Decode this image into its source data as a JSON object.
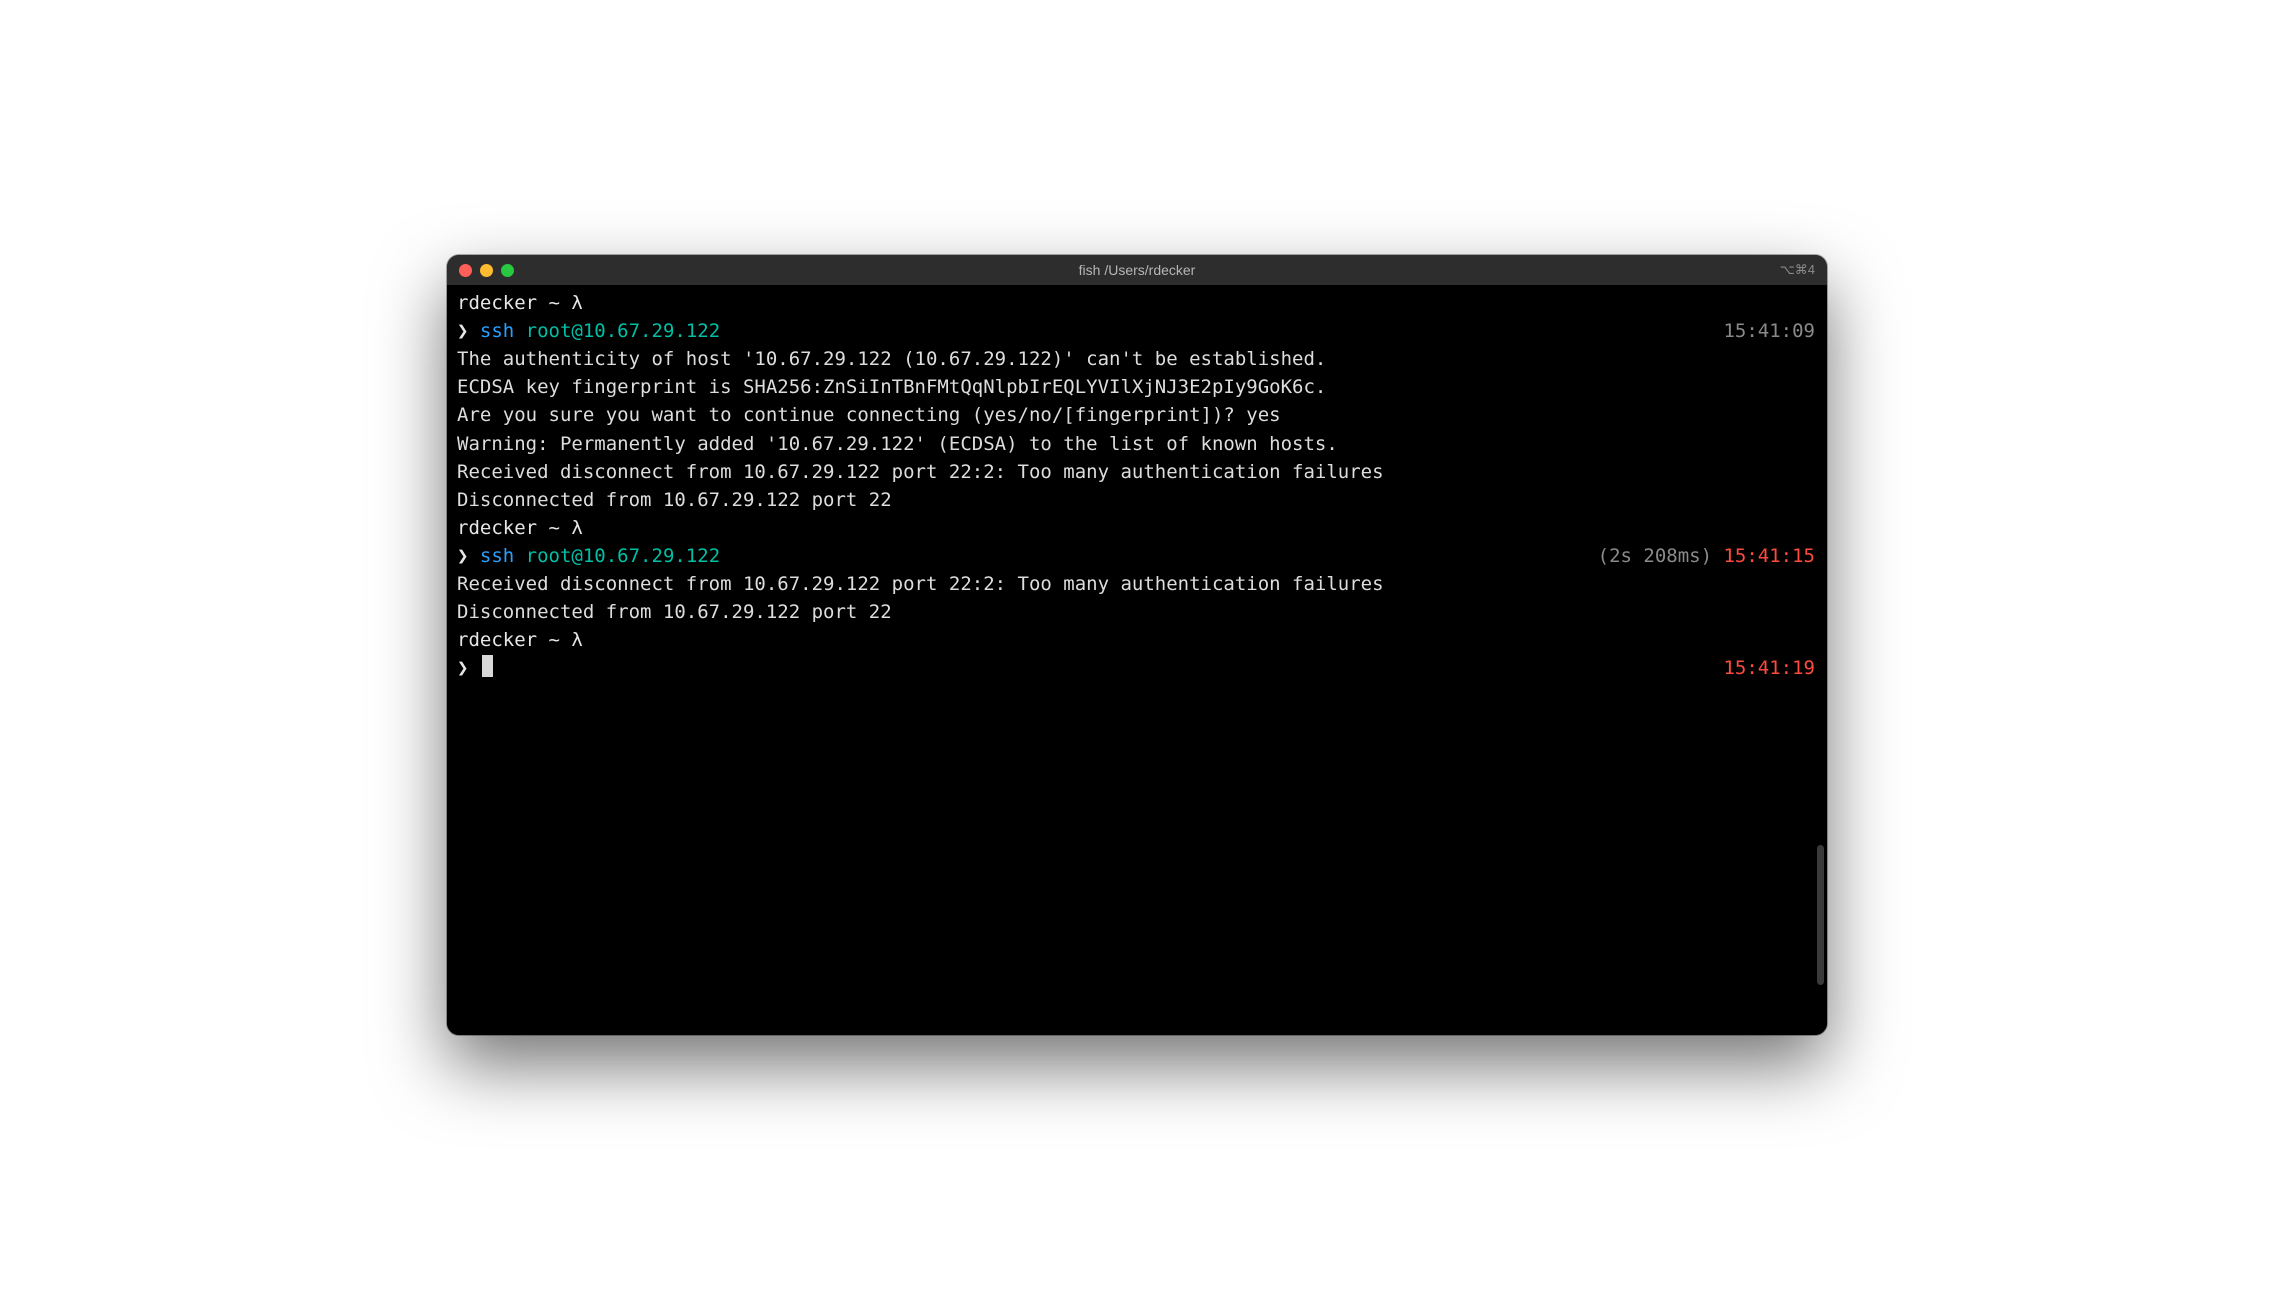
{
  "title": "fish /Users/rdecker",
  "title_right": "⌥⌘4",
  "prompt": {
    "user": "rdecker",
    "sep": " ~ ",
    "lambda": "λ",
    "arrow": "❯"
  },
  "blocks": [
    {
      "cmd": "ssh",
      "arg": "root@10.67.29.122",
      "time": "15:41:09",
      "time_class": "gray",
      "output": [
        "The authenticity of host '10.67.29.122 (10.67.29.122)' can't be established.",
        "ECDSA key fingerprint is SHA256:ZnSiInTBnFMtQqNlpbIrEQLYVIlXjNJ3E2pIy9GoK6c.",
        "Are you sure you want to continue connecting (yes/no/[fingerprint])? yes",
        "Warning: Permanently added '10.67.29.122' (ECDSA) to the list of known hosts.",
        "Received disconnect from 10.67.29.122 port 22:2: Too many authentication failures",
        "Disconnected from 10.67.29.122 port 22"
      ]
    },
    {
      "cmd": "ssh",
      "arg": "root@10.67.29.122",
      "duration": "(2s 208ms)",
      "time": "15:41:15",
      "time_class": "red",
      "output": [
        "Received disconnect from 10.67.29.122 port 22:2: Too many authentication failures",
        "Disconnected from 10.67.29.122 port 22"
      ]
    }
  ],
  "current": {
    "time": "15:41:19",
    "time_class": "red"
  }
}
